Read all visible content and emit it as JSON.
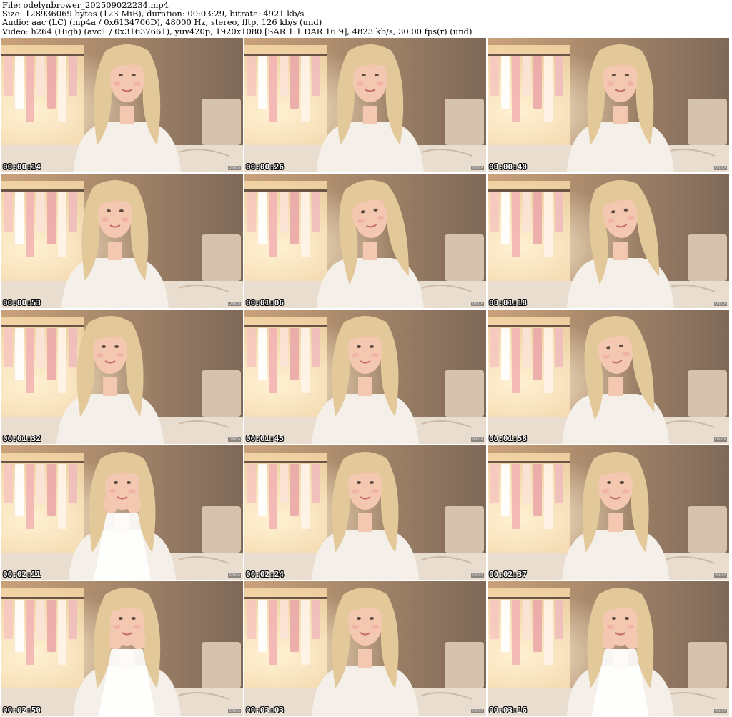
{
  "header": {
    "file": "File: odelynbrower_202509022234.mp4",
    "size": "Size: 128936069 bytes (123 MiB), duration: 00:03:29, bitrate: 4921 kb/s",
    "audio": "Audio: aac (LC) (mp4a / 0x6134706D), 48000 Hz, stereo, fltp, 126 kb/s (und)",
    "video": "Video: h264 (High) (avc1 / 0x31637661), yuv420p, 1920x1080 [SAR 1:1 DAR 16:9], 4823 kb/s, 30.00 fps(r) (und)"
  },
  "thumbnails": [
    {
      "time": "00:00:14",
      "face_x": 0.52,
      "pose": "neutral"
    },
    {
      "time": "00:00:26",
      "face_x": 0.52,
      "pose": "neutral"
    },
    {
      "time": "00:00:40",
      "face_x": 0.55,
      "pose": "neutral"
    },
    {
      "time": "00:00:53",
      "face_x": 0.47,
      "pose": "neutral"
    },
    {
      "time": "00:01:06",
      "face_x": 0.52,
      "pose": "tilt"
    },
    {
      "time": "00:01:18",
      "face_x": 0.55,
      "pose": "tilt"
    },
    {
      "time": "00:01:32",
      "face_x": 0.45,
      "pose": "neutral"
    },
    {
      "time": "00:01:45",
      "face_x": 0.5,
      "pose": "neutral"
    },
    {
      "time": "00:01:58",
      "face_x": 0.53,
      "pose": "tilt"
    },
    {
      "time": "00:02:11",
      "face_x": 0.5,
      "pose": "heart"
    },
    {
      "time": "00:02:24",
      "face_x": 0.5,
      "pose": "neutral"
    },
    {
      "time": "00:02:37",
      "face_x": 0.53,
      "pose": "neutral"
    },
    {
      "time": "00:02:50",
      "face_x": 0.52,
      "pose": "heart"
    },
    {
      "time": "00:03:03",
      "face_x": 0.5,
      "pose": "neutral"
    },
    {
      "time": "00:03:16",
      "face_x": 0.55,
      "pose": "hands"
    }
  ],
  "watermark": "ONICA",
  "colors": {
    "wall": "#8a7464",
    "wardrobe_light": "#f7d8a8",
    "pink_clothes": "#f2b4b4",
    "hair": "#e3c89a",
    "skin": "#f3c7b0",
    "blouse": "#f4efe8",
    "bed": "#e9ddd0",
    "headboard": "#d6c3ad"
  }
}
